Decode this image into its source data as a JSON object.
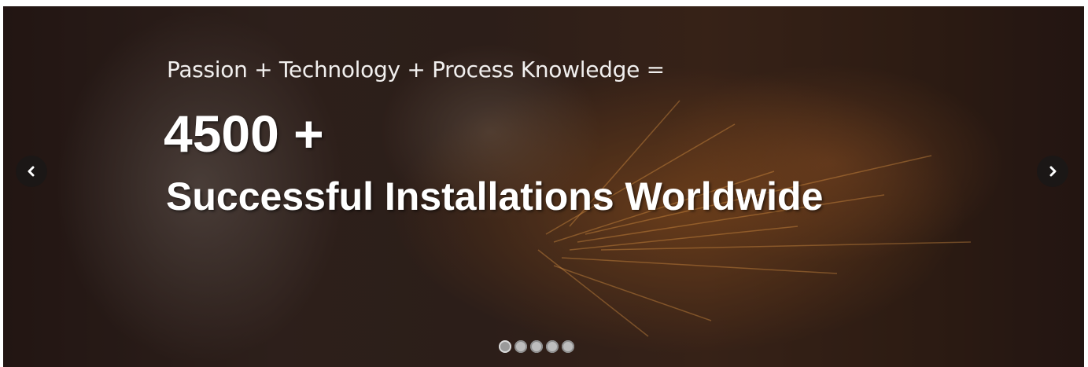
{
  "slider": {
    "subtitle": "Passion + Technology + Process Knowledge =",
    "headline_number": "4500 +",
    "headline_text": "Successful Installations Worldwide",
    "prev_icon": "chevron-left-icon",
    "next_icon": "chevron-right-icon",
    "slide_count": 5,
    "active_slide": 1
  },
  "colors": {
    "arrow_bg": "#1b1716",
    "text": "#ffffff",
    "dot": "#bdbdbd"
  }
}
